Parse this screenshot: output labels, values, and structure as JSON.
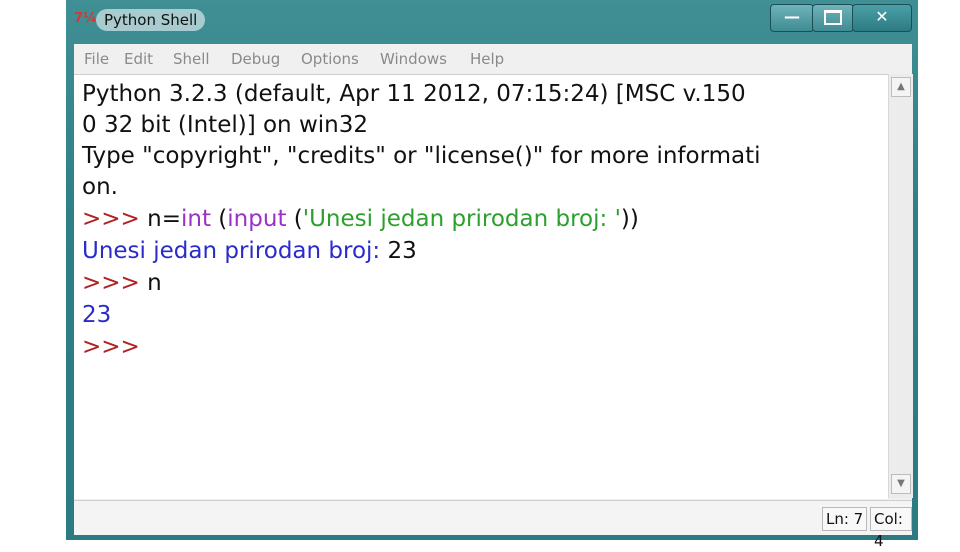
{
  "window": {
    "title": "Python Shell",
    "icon": "python-idle-icon"
  },
  "menu": [
    "File",
    "Edit",
    "Shell",
    "Debug",
    "Options",
    "Windows",
    "Help"
  ],
  "shell": {
    "banner1": "Python 3.2.3 (default, Apr 11 2012, 07:15:24) [MSC v.150",
    "banner2": "0 32 bit (Intel)] on win32",
    "banner3": "Type \"copyright\", \"credits\" or \"license()\" for more informati",
    "banner4": "on.",
    "prompt": ">>>",
    "cmd1": {
      "pre": " n=",
      "kw1": "int",
      "mid": " (",
      "kw2": "input",
      "mid2": " (",
      "str": "'Unesi jedan prirodan broj: '",
      "end": "))"
    },
    "out1_prompt": "Unesi jedan prirodan broj:",
    "out1_input": " 23",
    "cmd2": " n",
    "out2": "23"
  },
  "status": {
    "line": "Ln: 7",
    "col": "Col: 4"
  },
  "colors": {
    "prompt": "#b22222",
    "keyword": "#9b30c8",
    "string": "#2ca02c",
    "output": "#2b2bcc"
  }
}
